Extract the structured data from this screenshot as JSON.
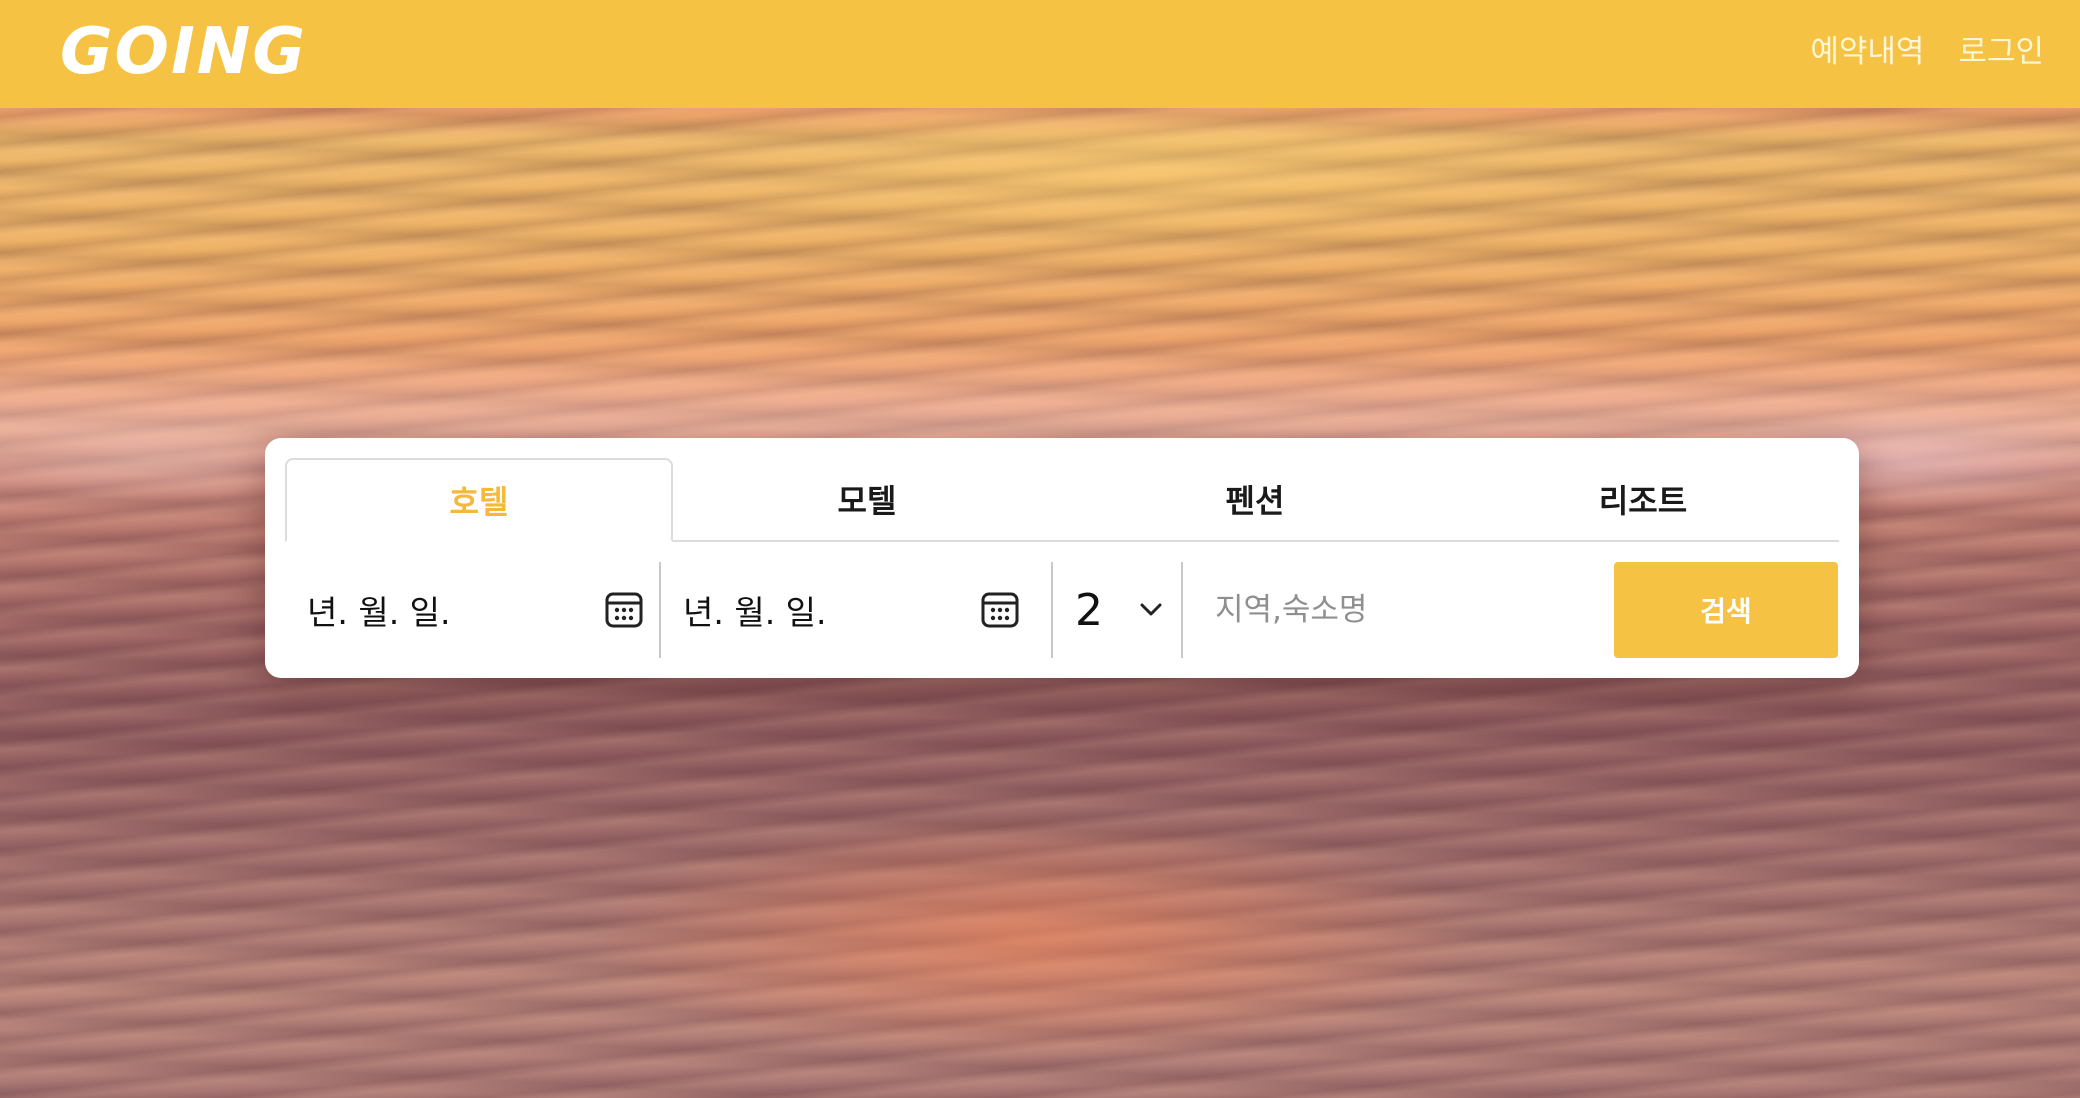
{
  "header": {
    "logo": "GOING",
    "nav": [
      {
        "label": "예약내역"
      },
      {
        "label": "로그인"
      }
    ]
  },
  "search": {
    "tabs": [
      {
        "label": "호텔",
        "active": true
      },
      {
        "label": "모텔",
        "active": false
      },
      {
        "label": "펜션",
        "active": false
      },
      {
        "label": "리조트",
        "active": false
      }
    ],
    "checkin": {
      "value": "년. 월. 일.",
      "icon": "calendar-icon"
    },
    "checkout": {
      "value": "년. 월. 일.",
      "icon": "calendar-icon"
    },
    "guests": {
      "value": "2",
      "icon": "chevron-down-icon"
    },
    "place": {
      "placeholder": "지역,숙소명",
      "value": ""
    },
    "submit_label": "검색"
  },
  "colors": {
    "brand": "#f5c243",
    "active_tab": "#f5b83a"
  }
}
